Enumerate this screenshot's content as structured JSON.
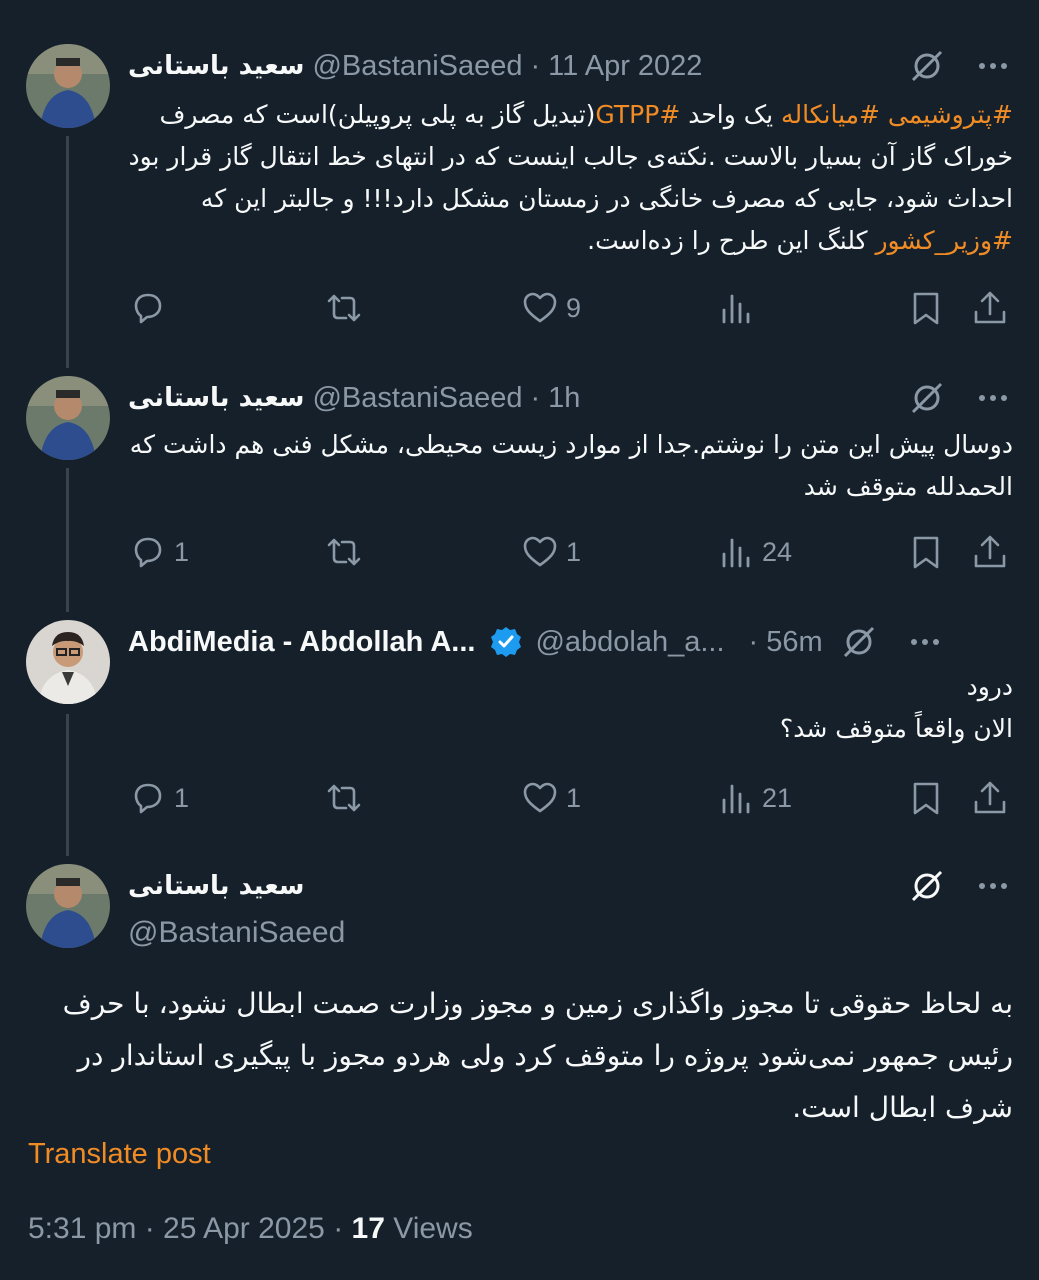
{
  "colors": {
    "background": "#15202b",
    "text": "#f7f9f9",
    "muted": "#8b98a5",
    "accent": "#f18c25",
    "verified": "#1d9bf0"
  },
  "tweets": [
    {
      "name": "سعید باستانی",
      "handle": "@BastaniSaeed",
      "time": "11 Apr 2022",
      "body_parts": [
        {
          "text": "#پتروشیمی #میانکاله",
          "hashtag": true
        },
        {
          "text": " یک واحد ",
          "hashtag": false
        },
        {
          "text": "#GTPP",
          "hashtag": true
        },
        {
          "text": "(تبدیل گاز به پلی پروپیلن)است که مصرف خوراک گاز آن بسیار بالاست .نکته‌ی جالب اینست که در انتهای خط انتقال گاز قرار بود احداث شود، جایی که مصرف خانگی در زمستان مشکل دارد!!! و جالبتر این که ",
          "hashtag": false
        },
        {
          "text": "#وزیر_کشور",
          "hashtag": true
        },
        {
          "text": " کلنگ این طرح را زده‌است.",
          "hashtag": false
        }
      ],
      "replies": "",
      "retweets": "",
      "likes": "9",
      "views": ""
    },
    {
      "name": "سعید باستانی",
      "handle": "@BastaniSaeed",
      "time": "1h",
      "body": "دوسال پیش این متن را نوشتم.جدا از موارد زیست محیطی، مشکل فنی هم داشت که الحمدلله متوقف شد",
      "replies": "1",
      "retweets": "",
      "likes": "1",
      "views": "24"
    },
    {
      "name": "AbdiMedia - Abdollah A...",
      "handle": "@abdolah_a...",
      "time": "56m",
      "body_line1": "درود",
      "body_line2": "الان واقعاً متوقف شد؟",
      "replies": "1",
      "retweets": "",
      "likes": "1",
      "views": "21"
    }
  ],
  "main_tweet": {
    "name": "سعید باستانی",
    "handle": "@BastaniSaeed",
    "body": "به لحاظ حقوقی تا مجوز واگذاری زمین و مجوز وزارت صمت ابطال نشود، با حرف رئیس جمهور نمی‌شود پروژه را متوقف کرد ولی هردو مجوز با پیگیری استاندار در شرف ابطال است.",
    "translate": "Translate post",
    "timestamp": "5:31 pm · 25 Apr 2025 · ",
    "views_count": "17",
    "views_label": " Views"
  },
  "icons": {
    "reply": "reply-icon",
    "retweet": "retweet-icon",
    "like": "like-icon",
    "views": "views-icon",
    "bookmark": "bookmark-icon",
    "share": "share-icon",
    "grok": "grok-icon",
    "more": "more-icon",
    "verified": "verified-icon"
  }
}
